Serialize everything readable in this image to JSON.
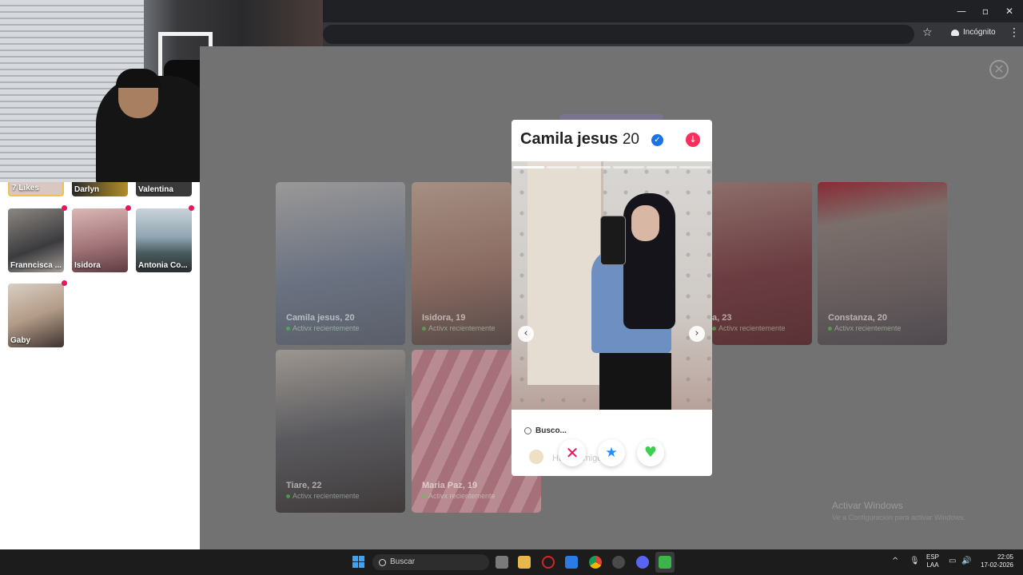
{
  "browser": {
    "incognito_label": "Incógnito",
    "window_controls": {
      "minimize": "—",
      "restore": "▫",
      "close": "✕"
    }
  },
  "sidebar": {
    "likes_label": "7 Likes",
    "matches": [
      {
        "name": "Darlyn"
      },
      {
        "name": "Valentina"
      },
      {
        "name": "Franncisca ..."
      },
      {
        "name": "Isidora"
      },
      {
        "name": "Antonia Co..."
      },
      {
        "name": "Gaby"
      }
    ]
  },
  "background_cards": [
    {
      "name": "Camila jesus, 20",
      "status": "Activx recientemente"
    },
    {
      "name": "Isidora, 19",
      "status": "Activx recientemente"
    },
    {
      "name": "a, 23",
      "status": "Activx recientemente"
    },
    {
      "name": "Constanza, 20",
      "status": "Activx recientemente"
    },
    {
      "name": "Tiare, 22",
      "status": "Activx recientemente"
    },
    {
      "name": "Maria Paz, 19",
      "status": "Activx recientemente"
    }
  ],
  "profile": {
    "name": "Camila jesus",
    "age": "20",
    "verified_icon": "✓",
    "photo_count": 6,
    "active_photo": 1,
    "looking_for_label": "Busco...",
    "looking_for_value": "Hacer amigos",
    "actions": {
      "nope": "✕",
      "super_like": "★",
      "like": "♥"
    }
  },
  "windows_watermark": {
    "title": "Activar Windows",
    "subtitle": "Ve a Configuración para activar Windows."
  },
  "taskbar": {
    "search_placeholder": "Buscar",
    "language": "ESP",
    "layout": "LAA",
    "time": "22:05",
    "date": "17-02-2026"
  },
  "colors": {
    "accent_pink": "#fd2d5d",
    "verified_blue": "#1a73e8",
    "like_green": "#3ecf4f",
    "superlike_blue": "#1d8fff"
  }
}
